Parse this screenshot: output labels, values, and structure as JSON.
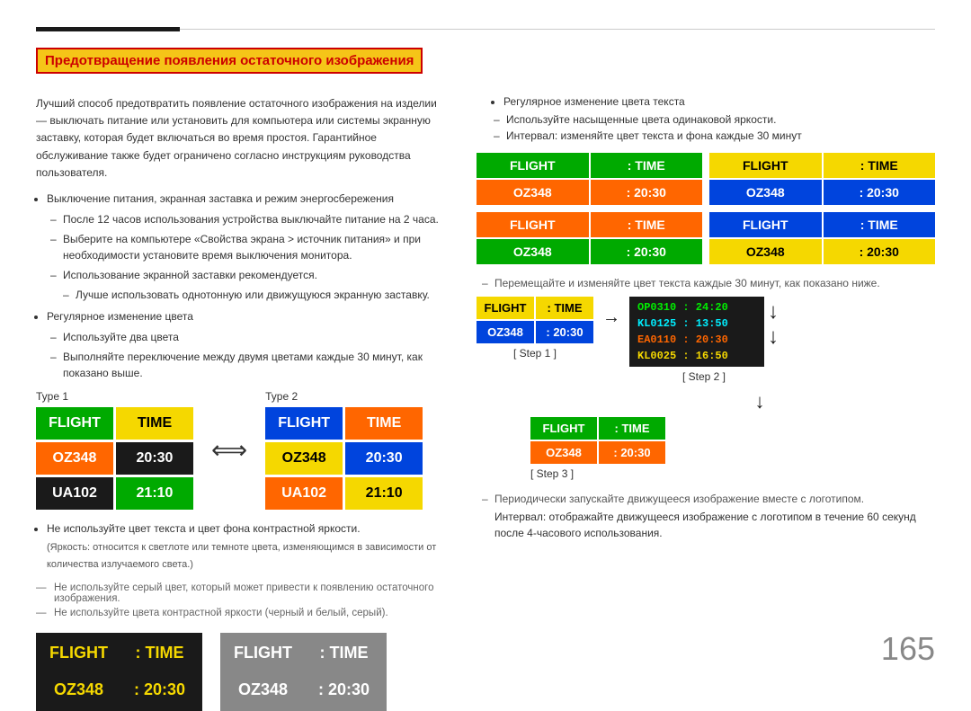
{
  "page": {
    "number": "165"
  },
  "heading": "Предотвращение появления остаточного изображения",
  "intro_text": "Лучший способ предотвратить появление остаточного изображения на изделии — выключать питание или установить для компьютера или системы экранную заставку, которая будет включаться во время простоя. Гарантийное обслуживание также будет ограничено согласно инструкциям руководства пользователя.",
  "left_bullet1": "Выключение питания, экранная заставка и режим энергосбережения",
  "left_sub1": "После 12 часов использования устройства выключайте питание на 2 часа.",
  "left_sub2": "Выберите на компьютере «Свойства экрана > источник питания» и при необходимости установите время выключения монитора.",
  "left_sub3": "Использование экранной заставки рекомендуется.",
  "left_sub3b": "Лучше использовать однотонную или движущуюся экранную заставку.",
  "left_bullet2": "Регулярное изменение цвета",
  "left_sub4": "Используйте два цвета",
  "left_sub5": "Выполняйте переключение между двумя цветами каждые 30 минут, как показано выше.",
  "type1_label": "Type 1",
  "type2_label": "Type 2",
  "board1": {
    "cells": [
      {
        "text": "FLIGHT",
        "bg": "#00aa00",
        "fg": "#fff"
      },
      {
        "text": "TIME",
        "bg": "#f5d800",
        "fg": "#000"
      },
      {
        "text": "OZ348",
        "bg": "#ff6600",
        "fg": "#fff"
      },
      {
        "text": "20:30",
        "bg": "#1a1a1a",
        "fg": "#fff"
      },
      {
        "text": "UA102",
        "bg": "#1a1a1a",
        "fg": "#fff"
      },
      {
        "text": "21:10",
        "bg": "#00aa00",
        "fg": "#fff"
      }
    ]
  },
  "board2": {
    "cells": [
      {
        "text": "FLIGHT",
        "bg": "#0044dd",
        "fg": "#fff"
      },
      {
        "text": "TIME",
        "bg": "#ff6600",
        "fg": "#fff"
      },
      {
        "text": "OZ348",
        "bg": "#f5d800",
        "fg": "#000"
      },
      {
        "text": "20:30",
        "bg": "#0044dd",
        "fg": "#fff"
      },
      {
        "text": "UA102",
        "bg": "#ff6600",
        "fg": "#fff"
      },
      {
        "text": "21:10",
        "bg": "#f5d800",
        "fg": "#000"
      }
    ]
  },
  "contrast_note": "Не используйте цвет текста и цвет фона контрастной яркости.",
  "contrast_note2": "(Яркость: относится к светлоте или темноте цвета, изменяющимся в зависимости от количества излучаемого света.)",
  "gray_note1": "Не используйте серый цвет, который может привести к появлению остаточного изображения.",
  "gray_note2": "Не используйте цвета контрастной яркости (черный и белый, серый).",
  "bottom_board1": {
    "label": "",
    "bg": "#1a1a1a",
    "row1": [
      {
        "text": "FLIGHT",
        "bg": "#1a1a1a",
        "fg": "#f5d800"
      },
      {
        "text": "TIME",
        "bg": "#1a1a1a",
        "fg": "#f5d800"
      }
    ],
    "row2": [
      {
        "text": "OZ348",
        "bg": "#1a1a1a",
        "fg": "#f5d800"
      },
      {
        "text": "20:30",
        "bg": "#1a1a1a",
        "fg": "#f5d800"
      }
    ]
  },
  "bottom_board2": {
    "bg": "#888",
    "row1": [
      {
        "text": "FLIGHT",
        "bg": "#888",
        "fg": "#fff"
      },
      {
        "text": "TIME",
        "bg": "#888",
        "fg": "#fff"
      }
    ],
    "row2": [
      {
        "text": "OZ348",
        "bg": "#888",
        "fg": "#fff"
      },
      {
        "text": "20:30",
        "bg": "#888",
        "fg": "#fff"
      }
    ]
  },
  "right_bullet1": "Регулярное изменение цвета текста",
  "right_sub1": "Используйте насыщенные цвета одинаковой яркости.",
  "right_sub2": "Интервал: изменяйте цвет текста и фона каждые 30 минут",
  "mini_boards": [
    {
      "row1": [
        {
          "text": "FLIGHT",
          "bg": "#00aa00",
          "fg": "#fff"
        },
        {
          "text": "TIME",
          "bg": "#00aa00",
          "fg": "#fff"
        }
      ],
      "row2": [
        {
          "text": "OZ348",
          "bg": "#00aa00",
          "fg": "#fff"
        },
        {
          "text": "20:30",
          "bg": "#f5d800",
          "fg": "#000"
        }
      ]
    },
    {
      "row1": [
        {
          "text": "FLIGHT",
          "bg": "#f5d800",
          "fg": "#000"
        },
        {
          "text": "TIME",
          "bg": "#f5d800",
          "fg": "#000"
        }
      ],
      "row2": [
        {
          "text": "OZ348",
          "bg": "#ff6600",
          "fg": "#fff"
        },
        {
          "text": "20:30",
          "bg": "#ff6600",
          "fg": "#fff"
        }
      ]
    },
    {
      "row1": [
        {
          "text": "FLIGHT",
          "bg": "#ff6600",
          "fg": "#fff"
        },
        {
          "text": "TIME",
          "bg": "#ff6600",
          "fg": "#fff"
        }
      ],
      "row2": [
        {
          "text": "OZ348",
          "bg": "#0044dd",
          "fg": "#fff"
        },
        {
          "text": "20:30",
          "bg": "#0044dd",
          "fg": "#fff"
        }
      ]
    },
    {
      "row1": [
        {
          "text": "FLIGHT",
          "bg": "#0044dd",
          "fg": "#fff"
        },
        {
          "text": "TIME",
          "bg": "#0044dd",
          "fg": "#fff"
        }
      ],
      "row2": [
        {
          "text": "OZ348",
          "bg": "#00aa00",
          "fg": "#fff"
        },
        {
          "text": "20:30",
          "bg": "#00aa00",
          "fg": "#fff"
        }
      ]
    }
  ],
  "step_note": "Перемещайте и изменяйте цвет текста каждые 30 минут, как показано ниже.",
  "step1_label": "[ Step 1 ]",
  "step2_label": "[ Step 2 ]",
  "step3_label": "[ Step 3 ]",
  "step1_board": {
    "row1": [
      {
        "text": "FLIGHT",
        "bg": "#f5d800",
        "fg": "#000"
      },
      {
        "text": "TIME",
        "bg": "#f5d800",
        "fg": "#000"
      }
    ],
    "row2": [
      {
        "text": "OZ348",
        "bg": "#0044dd",
        "fg": "#fff"
      },
      {
        "text": "20:30",
        "bg": "#0044dd",
        "fg": "#fff"
      }
    ]
  },
  "step2_rows": [
    {
      "text": "OP0310 : 24:20",
      "fg": "#00ee00"
    },
    {
      "text": "KL0125 : 13:50",
      "fg": "#00eeff"
    },
    {
      "text": "EA0110 : 20:30",
      "fg": "#ff6600"
    },
    {
      "text": "KL0025 : 16:50",
      "fg": "#f5d800"
    }
  ],
  "step3_board": {
    "row1": [
      {
        "text": "FLIGHT",
        "bg": "#00aa00",
        "fg": "#fff"
      },
      {
        "text": "TIME",
        "bg": "#00aa00",
        "fg": "#fff"
      }
    ],
    "row2": [
      {
        "text": "OZ348",
        "bg": "#ff6600",
        "fg": "#fff"
      },
      {
        "text": "20:30",
        "bg": "#ff6600",
        "fg": "#fff"
      }
    ]
  },
  "bottom_note1": "Периодически запускайте движущееся изображение вместе с логотипом.",
  "bottom_note2": "Интервал: отображайте движущееся изображение с логотипом в течение 60 секунд после 4-часового использования."
}
